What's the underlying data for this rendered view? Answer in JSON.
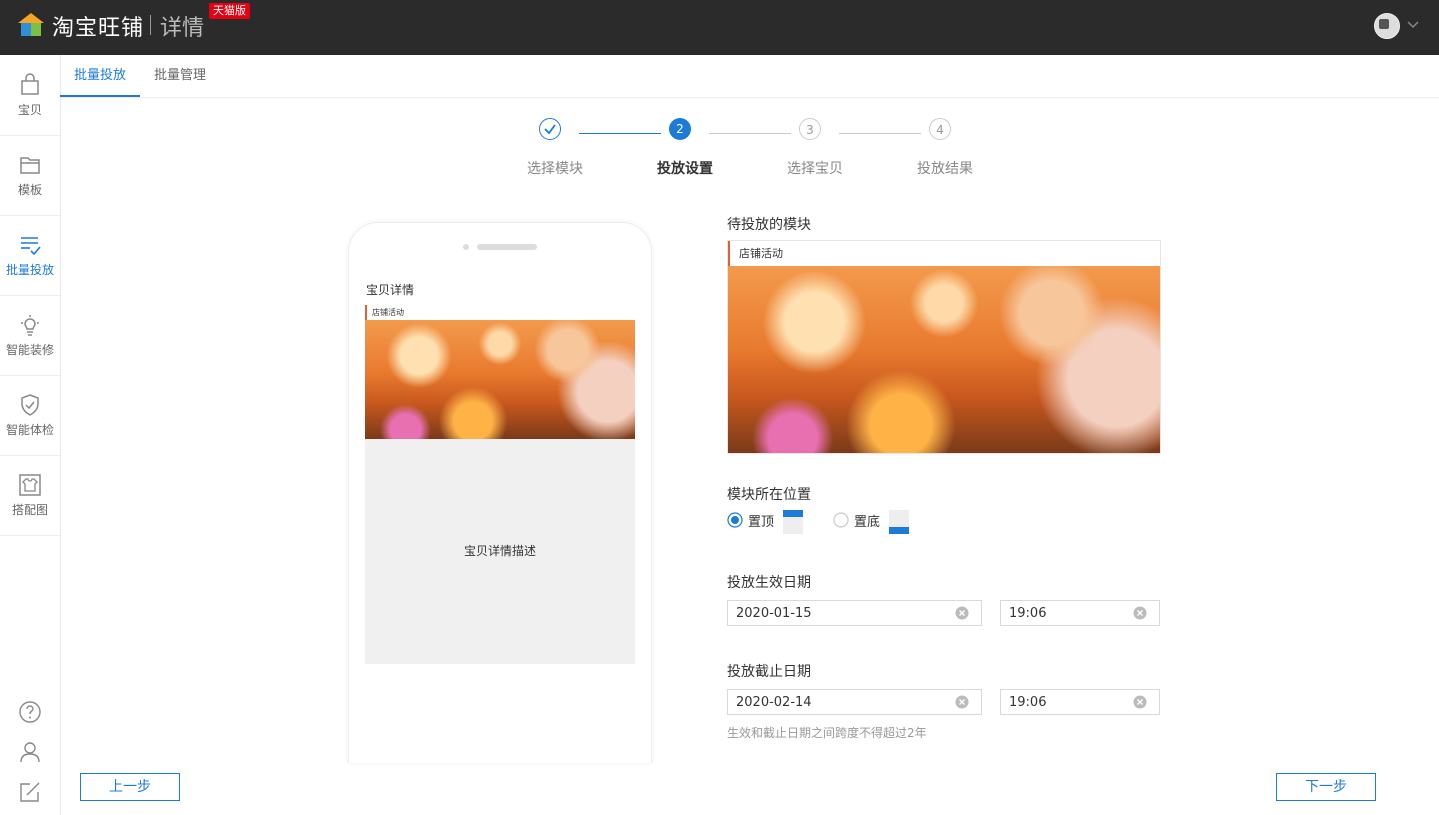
{
  "header": {
    "logo_text": "淘宝旺铺",
    "logo_sub": "详情",
    "badge": "天猫版"
  },
  "sidebar": {
    "items": [
      {
        "label": "宝贝",
        "icon": "bag-icon"
      },
      {
        "label": "模板",
        "icon": "folder-icon"
      },
      {
        "label": "批量投放",
        "icon": "list-check-icon"
      },
      {
        "label": "智能装修",
        "icon": "bulb-icon"
      },
      {
        "label": "智能体检",
        "icon": "shield-check-icon"
      },
      {
        "label": "搭配图",
        "icon": "shirt-icon"
      }
    ],
    "bottom_icons": [
      "help-icon",
      "user-icon",
      "edit-icon"
    ]
  },
  "tabs": [
    {
      "label": "批量投放"
    },
    {
      "label": "批量管理"
    }
  ],
  "steps": [
    {
      "index": "1",
      "label": "选择模块",
      "state": "done"
    },
    {
      "index": "2",
      "label": "投放设置",
      "state": "active"
    },
    {
      "index": "3",
      "label": "选择宝贝",
      "state": "pending"
    },
    {
      "index": "4",
      "label": "投放结果",
      "state": "pending"
    }
  ],
  "phone": {
    "title": "宝贝详情",
    "module_label": "店铺活动",
    "desc_label": "宝贝详情描述"
  },
  "form": {
    "pending_module_label": "待投放的模块",
    "module_name": "店铺活动",
    "position_label": "模块所在位置",
    "position_options": [
      {
        "label": "置顶",
        "selected": true
      },
      {
        "label": "置底",
        "selected": false
      }
    ],
    "start_label": "投放生效日期",
    "start_date": "2020-01-15",
    "start_time": "19:06",
    "end_label": "投放截止日期",
    "end_date": "2020-02-14",
    "end_time": "19:06",
    "hint": "生效和截止日期之间跨度不得超过2年"
  },
  "footer": {
    "prev_label": "上一步",
    "next_label": "下一步"
  },
  "colors": {
    "accent": "#1c7bd8",
    "topbar": "#2b2b2b",
    "badge": "#e60012"
  }
}
